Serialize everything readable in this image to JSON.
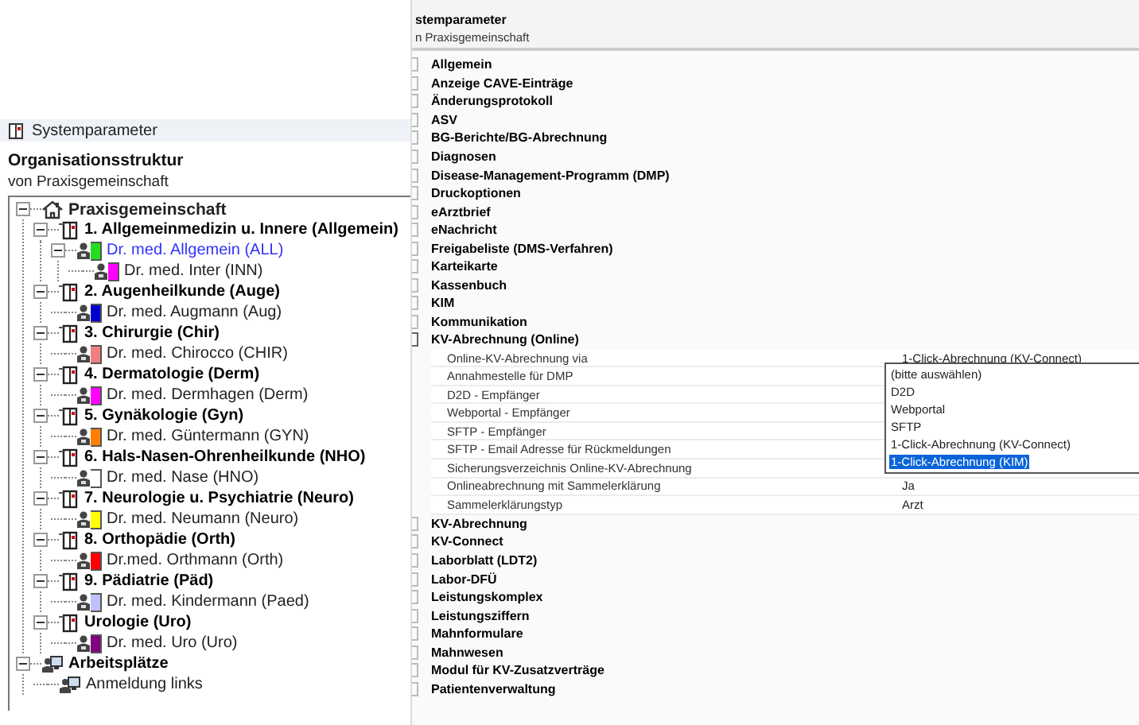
{
  "left_panel": {
    "header": "Systemparameter",
    "title": "Organisationsstruktur",
    "subtitle": "von Praxisgemeinschaft",
    "tree": [
      {
        "label": "Praxisgemeinschaft",
        "kind": "practice",
        "expanded": true,
        "children": [
          {
            "label": "1. Allgemeinmedizin u. Innere (Allgemein)",
            "kind": "department",
            "expanded": true,
            "children": [
              {
                "label": "Dr. med. Allgemein (ALL)",
                "kind": "doctor",
                "color": "#22dd22",
                "highlighted": true,
                "expanded": true,
                "children": [
                  {
                    "label": "Dr. med. Inter (INN)",
                    "kind": "doctor",
                    "color": "#ff00ff",
                    "highlighted": false
                  }
                ]
              }
            ]
          },
          {
            "label": "2. Augenheilkunde (Auge)",
            "kind": "department",
            "expanded": true,
            "children": [
              {
                "label": "Dr. med. Augmann (Aug)",
                "kind": "doctor",
                "color": "#0000cc",
                "highlighted": false
              }
            ]
          },
          {
            "label": "3. Chirurgie (Chir)",
            "kind": "department",
            "expanded": true,
            "children": [
              {
                "label": "Dr. med. Chirocco (CHIR)",
                "kind": "doctor",
                "color": "#f08080",
                "highlighted": false
              }
            ]
          },
          {
            "label": "4. Dermatologie (Derm)",
            "kind": "department",
            "expanded": true,
            "children": [
              {
                "label": "Dr. med. Dermhagen (Derm)",
                "kind": "doctor",
                "color": "#ff00ff",
                "highlighted": false
              }
            ]
          },
          {
            "label": "5. Gynäkologie (Gyn)",
            "kind": "department",
            "expanded": true,
            "children": [
              {
                "label": "Dr. med. Güntermann (GYN)",
                "kind": "doctor",
                "color": "#ff8000",
                "highlighted": false
              }
            ]
          },
          {
            "label": "6. Hals-Nasen-Ohrenheilkunde (NHO)",
            "kind": "department",
            "expanded": true,
            "children": [
              {
                "label": "Dr. med. Nase (HNO)",
                "kind": "doctor",
                "color": "#ffffff",
                "highlighted": false
              }
            ]
          },
          {
            "label": "7. Neurologie u. Psychiatrie (Neuro)",
            "kind": "department",
            "expanded": true,
            "children": [
              {
                "label": "Dr. med. Neumann (Neuro)",
                "kind": "doctor",
                "color": "#ffff00",
                "highlighted": false
              }
            ]
          },
          {
            "label": "8. Orthopädie (Orth)",
            "kind": "department",
            "expanded": true,
            "children": [
              {
                "label": "Dr.med. Orthmann (Orth)",
                "kind": "doctor",
                "color": "#ff0000",
                "highlighted": false
              }
            ]
          },
          {
            "label": "9. Pädiatrie (Päd)",
            "kind": "department",
            "expanded": true,
            "children": [
              {
                "label": "Dr. med. Kindermann (Paed)",
                "kind": "doctor",
                "color": "#c0c0ff",
                "highlighted": false
              }
            ]
          },
          {
            "label": "Urologie (Uro)",
            "kind": "department",
            "expanded": true,
            "children": [
              {
                "label": "Dr. med. Uro (Uro)",
                "kind": "doctor",
                "color": "#800080",
                "highlighted": false
              }
            ]
          }
        ]
      },
      {
        "label": "Arbeitsplätze",
        "kind": "workstations",
        "expanded": true,
        "children": [
          {
            "label": "Anmeldung links",
            "kind": "workstation"
          }
        ]
      }
    ]
  },
  "right_panel": {
    "title": "stemparameter",
    "subtitle": "n Praxisgemeinschaft",
    "groups": [
      {
        "label": "Allgemein",
        "expanded": false
      },
      {
        "label": "Anzeige CAVE-Einträge",
        "expanded": false
      },
      {
        "label": "Änderungsprotokoll",
        "expanded": false
      },
      {
        "label": "ASV",
        "expanded": false
      },
      {
        "label": "BG-Berichte/BG-Abrechnung",
        "expanded": false
      },
      {
        "label": "Diagnosen",
        "expanded": false
      },
      {
        "label": "Disease-Management-Programm (DMP)",
        "expanded": false
      },
      {
        "label": "Druckoptionen",
        "expanded": false
      },
      {
        "label": "eArztbrief",
        "expanded": false
      },
      {
        "label": "eNachricht",
        "expanded": false
      },
      {
        "label": "Freigabeliste (DMS-Verfahren)",
        "expanded": false
      },
      {
        "label": "Karteikarte",
        "expanded": false
      },
      {
        "label": "Kassenbuch",
        "expanded": false
      },
      {
        "label": "KIM",
        "expanded": false
      },
      {
        "label": "Kommunikation",
        "expanded": false
      },
      {
        "label": "KV-Abrechnung (Online)",
        "expanded": true,
        "settings": [
          {
            "label": "Online-KV-Abrechnung via",
            "value": "1-Click-Abrechnung (KV-Connect)"
          },
          {
            "label": "Annahmestelle für DMP"
          },
          {
            "label": "D2D - Empfänger"
          },
          {
            "label": "Webportal - Empfänger"
          },
          {
            "label": "SFTP - Empfänger"
          },
          {
            "label": "SFTP - Email Adresse für Rückmeldungen"
          },
          {
            "label": "Sicherungsverzeichnis Online-KV-Abrechnung"
          },
          {
            "label": "Onlineabrechnung mit Sammelerklärung",
            "value": "Ja"
          },
          {
            "label": "Sammelerklärungstyp",
            "value": "Arzt"
          }
        ]
      },
      {
        "label": "KV-Abrechnung",
        "expanded": false
      },
      {
        "label": "KV-Connect",
        "expanded": false
      },
      {
        "label": "Laborblatt (LDT2)",
        "expanded": false
      },
      {
        "label": "Labor-DFÜ",
        "expanded": false
      },
      {
        "label": "Leistungskomplex",
        "expanded": false
      },
      {
        "label": "Leistungsziffern",
        "expanded": false
      },
      {
        "label": "Mahnformulare",
        "expanded": false
      },
      {
        "label": "Mahnwesen",
        "expanded": false
      },
      {
        "label": "Modul für KV-Zusatzverträge",
        "expanded": false
      },
      {
        "label": "Patientenverwaltung",
        "expanded": false
      }
    ],
    "dropdown": {
      "options": [
        {
          "label": "(bitte auswählen)",
          "selected": false
        },
        {
          "label": "D2D",
          "selected": false
        },
        {
          "label": "Webportal",
          "selected": false
        },
        {
          "label": "SFTP",
          "selected": false
        },
        {
          "label": "1-Click-Abrechnung (KV-Connect)",
          "selected": false
        },
        {
          "label": "1-Click-Abrechnung (KIM)",
          "selected": true
        }
      ]
    }
  }
}
